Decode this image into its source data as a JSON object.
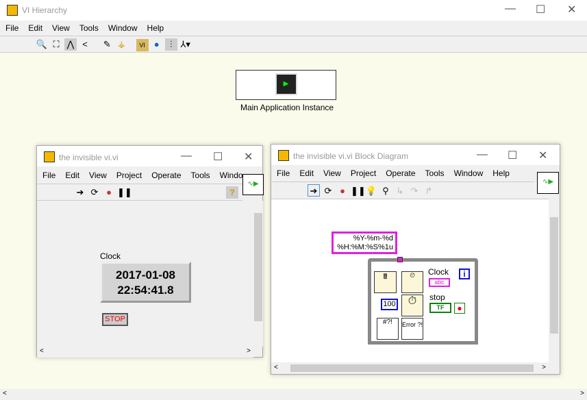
{
  "main": {
    "title": "VI Hierarchy",
    "menu": [
      "File",
      "Edit",
      "View",
      "Tools",
      "Window",
      "Help"
    ],
    "toolbar_icons": [
      "zoom-1x-icon",
      "zoom-fit-icon",
      "horizontal-layout-icon",
      "vertical-layout-icon",
      "edit-icon",
      "redo-layout-icon",
      "include-vi-lib-icon",
      "include-globals-icon",
      "include-typedefs-icon",
      "show-all-icon"
    ],
    "node_label": "Main Application Instance",
    "canvas_color": "#fbfbec"
  },
  "front_panel": {
    "title": "the invisible vi.vi",
    "menu": [
      "File",
      "Edit",
      "View",
      "Project",
      "Operate",
      "Tools",
      "Windo"
    ],
    "clock_label": "Clock",
    "clock_date": "2017-01-08",
    "clock_time": "22:54:41.8",
    "stop_label": "STOP",
    "help_icon": "?"
  },
  "block_diagram": {
    "title": "the invisible vi.vi Block Diagram",
    "menu": [
      "File",
      "Edit",
      "View",
      "Project",
      "Operate",
      "Tools",
      "Window",
      "Help"
    ],
    "format_line1": "%Y-%m-%d",
    "format_line2": "%H:%M:%S%1u",
    "clock_label": "Clock",
    "clock_terminal": "abc",
    "stop_label": "stop",
    "stop_terminal": "TF",
    "wait_value": "100",
    "iteration": "i",
    "error_text": "Error ?!"
  }
}
